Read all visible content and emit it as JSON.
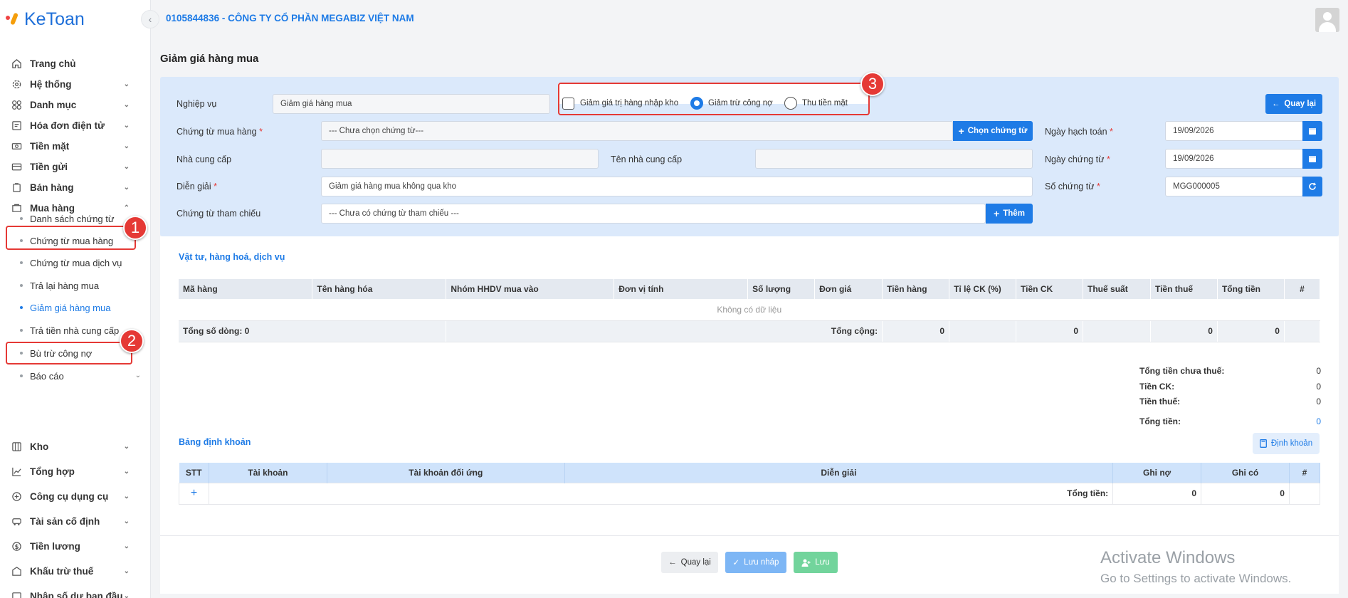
{
  "app": {
    "logo": "KeToan",
    "company": "0105844836 - CÔNG TY CỔ PHẦN MEGABIZ VIỆT NAM"
  },
  "sidebar": {
    "items": [
      {
        "label": "Trang chủ",
        "icon": "home-icon"
      },
      {
        "label": "Hệ thống",
        "icon": "gear-icon"
      },
      {
        "label": "Danh mục",
        "icon": "grid-icon"
      },
      {
        "label": "Hóa đơn điện tử",
        "icon": "invoice-icon"
      },
      {
        "label": "Tiền mặt",
        "icon": "cash-icon"
      },
      {
        "label": "Tiền gửi",
        "icon": "card-icon"
      },
      {
        "label": "Bán hàng",
        "icon": "sales-icon"
      },
      {
        "label": "Mua hàng",
        "icon": "purchase-icon"
      }
    ],
    "sub_items": [
      "Danh sách chứng từ",
      "Chứng từ mua hàng",
      "Chứng từ mua dịch vụ",
      "Trả lại hàng mua",
      "Giảm giá hàng mua",
      "Trả tiền nhà cung cấp",
      "Bù trừ công nợ",
      "Báo cáo"
    ],
    "items_bottom": [
      {
        "label": "Kho",
        "icon": "warehouse-icon"
      },
      {
        "label": "Tổng hợp",
        "icon": "chart-icon"
      },
      {
        "label": "Công cụ dụng cụ",
        "icon": "tools-icon"
      },
      {
        "label": "Tài sản cố định",
        "icon": "asset-icon"
      },
      {
        "label": "Tiền lương",
        "icon": "salary-icon"
      },
      {
        "label": "Khấu trừ thuế",
        "icon": "tax-icon"
      },
      {
        "label": "Nhập số dư ban đầu",
        "icon": "balance-icon"
      }
    ]
  },
  "annotations": [
    "1",
    "2",
    "3"
  ],
  "page": {
    "title": "Giảm giá hàng mua"
  },
  "form": {
    "nghiep_vu_label": "Nghiệp vụ",
    "nghiep_vu_value": "Giảm giá hàng mua",
    "options": [
      "Giảm giá trị hàng nhập kho",
      "Giảm trừ công nợ",
      "Thu tiền mặt"
    ],
    "back_top": "Quay lại",
    "chung_tu_label": "Chứng từ mua hàng",
    "chung_tu_placeholder": "--- Chưa chọn chứng từ---",
    "chon_chung_tu": "Chọn chứng từ",
    "ngay_hach_toan_label": "Ngày hạch toán",
    "ngay_hach_toan": "19/09/2026",
    "ncc_label": "Nhà cung cấp",
    "ten_ncc_label": "Tên nhà cung cấp",
    "ngay_chung_tu_label": "Ngày chứng từ",
    "ngay_chung_tu": "19/09/2026",
    "dien_giai_label": "Diễn giải",
    "dien_giai_value": "Giảm giá hàng mua không qua kho",
    "so_chung_tu_label": "Số chứng từ",
    "so_chung_tu": "MGG000005",
    "tham_chieu_label": "Chứng từ tham chiếu",
    "tham_chieu_placeholder": "--- Chưa có chứng từ tham chiếu ---",
    "them": "Thêm",
    "req": "*"
  },
  "items_table": {
    "title": "Vật tư, hàng hoá, dịch vụ",
    "columns": [
      "Mã hàng",
      "Tên hàng hóa",
      "Nhóm HHDV mua vào",
      "Đơn vị tính",
      "Số lượng",
      "Đơn giá",
      "Tiền hàng",
      "Tỉ lệ CK (%)",
      "Tiền CK",
      "Thuế suất",
      "Tiền thuế",
      "Tổng tiền",
      "#"
    ],
    "empty": "Không có dữ liệu",
    "total_rows": "Tổng số dòng: 0",
    "total_label": "Tổng cộng:",
    "totals": {
      "tien_hang": "0",
      "tien_ck": "0",
      "tien_thue": "0",
      "tong_tien": "0"
    }
  },
  "summary": {
    "rows": [
      {
        "label": "Tổng tiền chưa thuế:",
        "value": "0"
      },
      {
        "label": "Tiền CK:",
        "value": "0"
      },
      {
        "label": "Tiền thuế:",
        "value": "0"
      },
      {
        "label": "Tổng tiền:",
        "value": "0"
      }
    ]
  },
  "ledger": {
    "title": "Bảng định khoản",
    "dinh_khoan": "Định khoản",
    "columns": [
      "STT",
      "Tài khoản",
      "Tài khoản đối ứng",
      "Diễn giải",
      "Ghi nợ",
      "Ghi có",
      "#"
    ],
    "add": "+",
    "total_label": "Tổng tiền:",
    "ghi_no": "0",
    "ghi_co": "0"
  },
  "footer": {
    "back": "Quay lại",
    "save_draft": "Lưu nháp",
    "save": "Lưu"
  },
  "watermark": {
    "line1": "Activate Windows",
    "line2": "Go to Settings to activate Windows."
  },
  "colors": {
    "primary": "#1e7be6",
    "annotation": "#e53935",
    "panel": "#dbe9fb"
  }
}
